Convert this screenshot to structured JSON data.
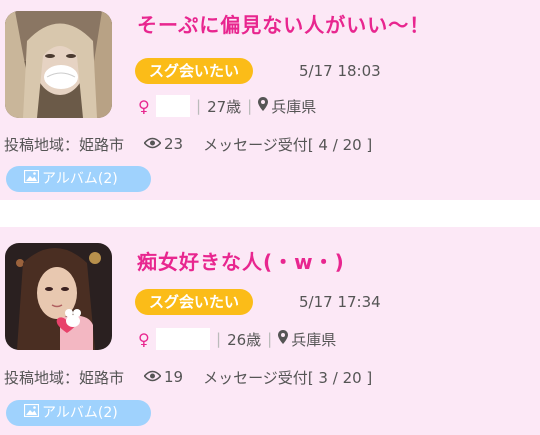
{
  "posts": [
    {
      "title": "そーぷに偏見ない人がいい〜！",
      "badge": "スグ会いたい",
      "datetime": "5/17 18:03",
      "gender_symbol": "♀",
      "age": "27歳",
      "location": "兵庫県",
      "area_label": "投稿地域：姫路市",
      "views": "23",
      "message_label": "メッセージ受付[ 4 / 20 ]",
      "album_label": "アルバム(2)"
    },
    {
      "title": "痴女好きな人(・w・)",
      "badge": "スグ会いたい",
      "datetime": "5/17 17:34",
      "gender_symbol": "♀",
      "age": "26歳",
      "location": "兵庫県",
      "area_label": "投稿地域：姫路市",
      "views": "19",
      "message_label": "メッセージ受付[ 3 / 20 ]",
      "album_label": "アルバム(2)"
    }
  ],
  "colors": {
    "card_bg": "#fce8f6",
    "title": "#e8268f",
    "badge": "#fbbc18",
    "album": "#9fd2fd",
    "text": "#555555"
  },
  "icons": [
    "female-icon",
    "pin-icon",
    "eye-icon",
    "image-icon"
  ]
}
